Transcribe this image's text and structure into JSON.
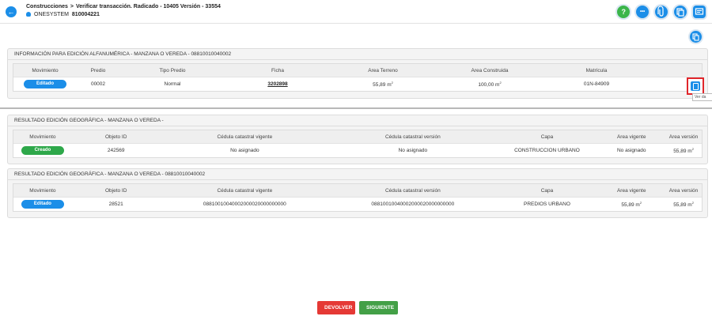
{
  "header": {
    "breadcrumb_root": "Construcciones",
    "breadcrumb_sep": ">",
    "breadcrumb_current": "Verificar transacción. Radicado - 10405 Versión - 33554",
    "user_label": "ONESYSTEM",
    "user_id": "810004221",
    "icons": [
      "help-icon",
      "more-icon",
      "attachment-icon",
      "copy-icon",
      "message-icon"
    ],
    "help_glyph": "?",
    "more_glyph": "•••"
  },
  "panel1": {
    "title": "INFORMACIÓN PARA EDICIÓN ALFANUMÉRICA - MANZANA O VEREDA - 08810010040002",
    "columns": [
      "Movimiento",
      "Predio",
      "Tipo Predio",
      "Ficha",
      "Área Terreno",
      "Área Construida",
      "Matrícula"
    ],
    "row": {
      "movimiento": "Editado",
      "predio": "00002",
      "tipo_predio": "Normal",
      "ficha": "3202898",
      "area_terreno": "55,89 m",
      "area_construida": "100,00 m",
      "matricula": "01N-84909"
    },
    "area_unit_sup": "2",
    "tooltip": "Ver da"
  },
  "panel2": {
    "title": "RESULTADO EDICIÓN GEOGRÁFICA - MANZANA O VEREDA -",
    "columns": [
      "Movimiento",
      "Objeto ID",
      "Cédula catastral vigente",
      "Cédula catastral versión",
      "Capa",
      "Área vigente",
      "Área versión"
    ],
    "row": {
      "movimiento": "Creado",
      "objeto_id": "242569",
      "cedula_vigente": "No asignado",
      "cedula_version": "No asignado",
      "capa": "CONSTRUCCION URBANO",
      "area_vigente": "No asignado",
      "area_version": "55,89 m"
    }
  },
  "panel3": {
    "title": "RESULTADO EDICIÓN GEOGRÁFICA - MANZANA O VEREDA - 08810010040002",
    "columns": [
      "Movimiento",
      "Objeto ID",
      "Cédula catastral vigente",
      "Cédula catastral versión",
      "Capa",
      "Área vigente",
      "Área versión"
    ],
    "row": {
      "movimiento": "Editado",
      "objeto_id": "28521",
      "cedula_vigente": "08810010040002000020000000000",
      "cedula_version": "08810010040002000020000000000",
      "capa": "PREDIOS URBANO",
      "area_vigente": "55,89 m",
      "area_version": "55,89 m"
    }
  },
  "actions": {
    "devolver": "DEVOLVER",
    "siguiente": "SIGUIENTE"
  },
  "colors": {
    "primary": "#1b8ee8",
    "success": "#2ea84a",
    "danger": "#e53935",
    "highlight_border": "#e0262b"
  }
}
